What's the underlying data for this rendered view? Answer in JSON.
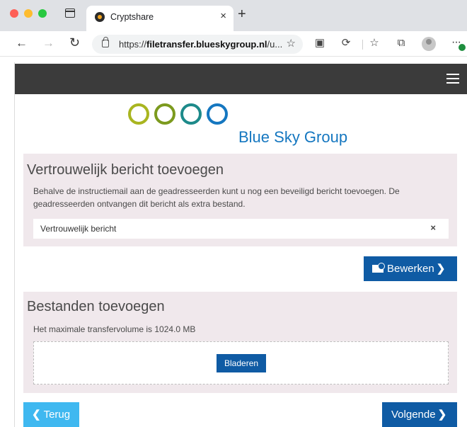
{
  "browser": {
    "tab_title": "Cryptshare",
    "tab_close": "×",
    "new_tab": "+",
    "url_prefix": "https://",
    "url_domain": "filetransfer.blueskygroup.nl",
    "url_suffix": "/u...",
    "icons": [
      "tab-actions-icon",
      "back-icon",
      "forward-icon",
      "reload-icon",
      "lock-icon",
      "add-favorite-icon",
      "extensions-icon",
      "sync-icon",
      "favorites-icon",
      "collections-icon",
      "profile-icon",
      "more-icon"
    ]
  },
  "site": {
    "logo_text": "Blue Sky Group",
    "logo_ring_colors": [
      "#a9b520",
      "#7c9a1e",
      "#1d8a8a",
      "#1577c0"
    ]
  },
  "message_section": {
    "title": "Vertrouwelijk bericht toevoegen",
    "description": "Behalve de instructiemail aan de geadresseerden kunt u nog een beveiligd bericht toevoegen. De geadresseerden ontvangen dit bericht als extra bestand.",
    "message_label": "Vertrouwelijk bericht",
    "remove_icon": "×",
    "edit_button": "Bewerken"
  },
  "files_section": {
    "title": "Bestanden toevoegen",
    "max_volume": "Het maximale transfervolume is 1024.0 MB",
    "browse_button": "Bladeren"
  },
  "footer": {
    "back_button": "Terug",
    "next_button": "Volgende"
  },
  "colors": {
    "primary": "#0f5ba4",
    "back_button": "#3fb8f0",
    "topbar": "#3b3b3b",
    "panel_bg": "#f0e8ec"
  }
}
